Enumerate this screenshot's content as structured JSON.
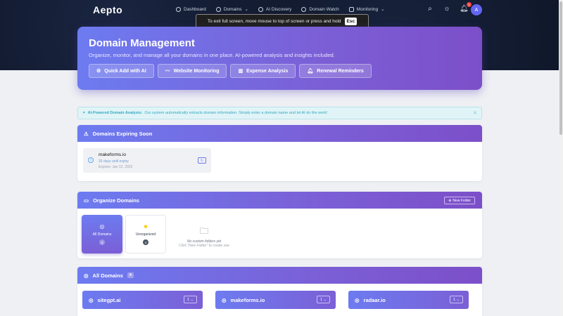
{
  "brand": {
    "logo": "Aepto"
  },
  "nav": {
    "items": [
      {
        "label": "Dashboard",
        "caret": ""
      },
      {
        "label": "Domains",
        "caret": "⌄"
      },
      {
        "label": "AI Discovery",
        "caret": ""
      },
      {
        "label": "Domain Watch",
        "caret": ""
      },
      {
        "label": "Monitoring",
        "caret": "⌄"
      }
    ],
    "notif_count": "0",
    "avatar": "A"
  },
  "fullscreen_toast": {
    "text": "To exit full screen, move mouse to top of screen or press and hold",
    "key": "Esc"
  },
  "hero": {
    "title": "Domain Management",
    "subtitle": "Organize, monitor, and manage all your domains in one place. AI-powered analysis and insights included.",
    "buttons": [
      "Quick Add with AI",
      "Website Monitoring",
      "Expense Analysis",
      "Renewal Reminders"
    ]
  },
  "info_banner": {
    "title": "AI-Powered Domain Analysis:",
    "text": "Our system automatically extracts domain information. Simply enter a domain name and let AI do the work!"
  },
  "expiring": {
    "title": "Domains Expiring Soon",
    "item": {
      "name": "makeforms.io",
      "days": "26 days until expiry",
      "date": "Expires: Jan 12, 2026"
    }
  },
  "organize": {
    "title": "Organize Domains",
    "new_folder": "New Folder",
    "folders": [
      {
        "label": "All Domains",
        "count": "4"
      },
      {
        "label": "Unorganized",
        "count": "4"
      }
    ],
    "empty_title": "No custom folders yet",
    "empty_hint": "Click \"New Folder\" to create one"
  },
  "all_domains": {
    "title": "All Domains",
    "count": "4",
    "cards": [
      {
        "name": "sitegpt.ai",
        "sel": "1"
      },
      {
        "name": "makeforms.io",
        "sel": "1"
      },
      {
        "name": "radaar.io",
        "sel": "1"
      }
    ]
  },
  "colors": {
    "accent": "#6d7bf0",
    "accent2": "#7c4fc9",
    "nav_bg": "#0f1729"
  }
}
